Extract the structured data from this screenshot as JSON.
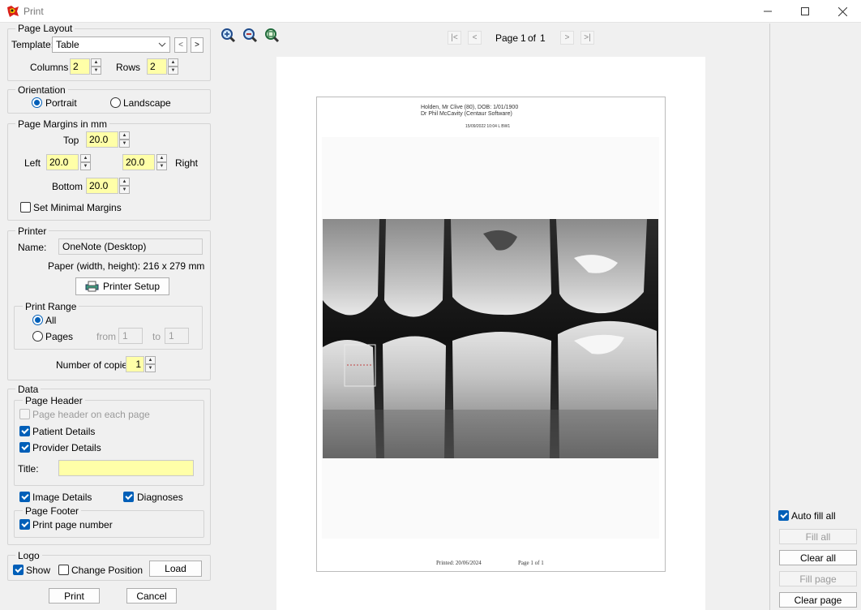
{
  "window": {
    "title": "Print"
  },
  "page_layout": {
    "legend": "Page Layout",
    "template_label": "Template:",
    "template_value": "Table",
    "columns_label": "Columns",
    "columns_value": "2",
    "rows_label": "Rows",
    "rows_value": "2"
  },
  "orientation": {
    "legend": "Orientation",
    "portrait": "Portrait",
    "landscape": "Landscape",
    "selected": "Portrait"
  },
  "margins": {
    "legend": "Page Margins in mm",
    "top_label": "Top",
    "top": "20.0",
    "left_label": "Left",
    "left": "20.0",
    "right_label": "Right",
    "right": "20.0",
    "bottom_label": "Bottom",
    "bottom": "20.0",
    "minimal_label": "Set Minimal Margins"
  },
  "printer": {
    "legend": "Printer",
    "name_label": "Name:",
    "name_value": "OneNote (Desktop)",
    "paper": "Paper (width, height): 216 x 279 mm",
    "setup_button": "Printer Setup",
    "range_legend": "Print Range",
    "all_label": "All",
    "pages_label": "Pages",
    "from_label": "from",
    "from_value": "1",
    "to_label": "to",
    "to_value": "1",
    "copies_label": "Number of copies",
    "copies_value": "1"
  },
  "data_section": {
    "legend": "Data",
    "header_legend": "Page Header",
    "header_each_page": "Page header on each page",
    "patient_details": "Patient Details",
    "provider_details": "Provider Details",
    "title_label": "Title:",
    "title_value": "",
    "image_details": "Image Details",
    "diagnoses": "Diagnoses",
    "footer_legend": "Page Footer",
    "print_page_number": "Print page number"
  },
  "logo": {
    "legend": "Logo",
    "show": "Show",
    "change_position": "Change Position",
    "load": "Load"
  },
  "actions": {
    "print": "Print",
    "cancel": "Cancel"
  },
  "toolbar": {
    "page_label": "Page",
    "page_current": "1",
    "page_of": "of",
    "page_total": "1"
  },
  "preview": {
    "patient_line": "Holden, Mr Clive (80), DOB: 1/01/1900",
    "provider_line": "Dr Phil McCavity (Centaur Software)",
    "image_line": "15/09/2022 10:04 L BW1",
    "printed": "Printed: 20/06/2024",
    "page_footer": "Page 1 of 1"
  },
  "right_panel": {
    "auto_fill_all": "Auto fill all",
    "fill_all": "Fill all",
    "clear_all": "Clear all",
    "fill_page": "Fill page",
    "clear_page": "Clear page"
  },
  "colors": {
    "accent": "#005fb8",
    "highlight_field": "#ffffa8"
  }
}
